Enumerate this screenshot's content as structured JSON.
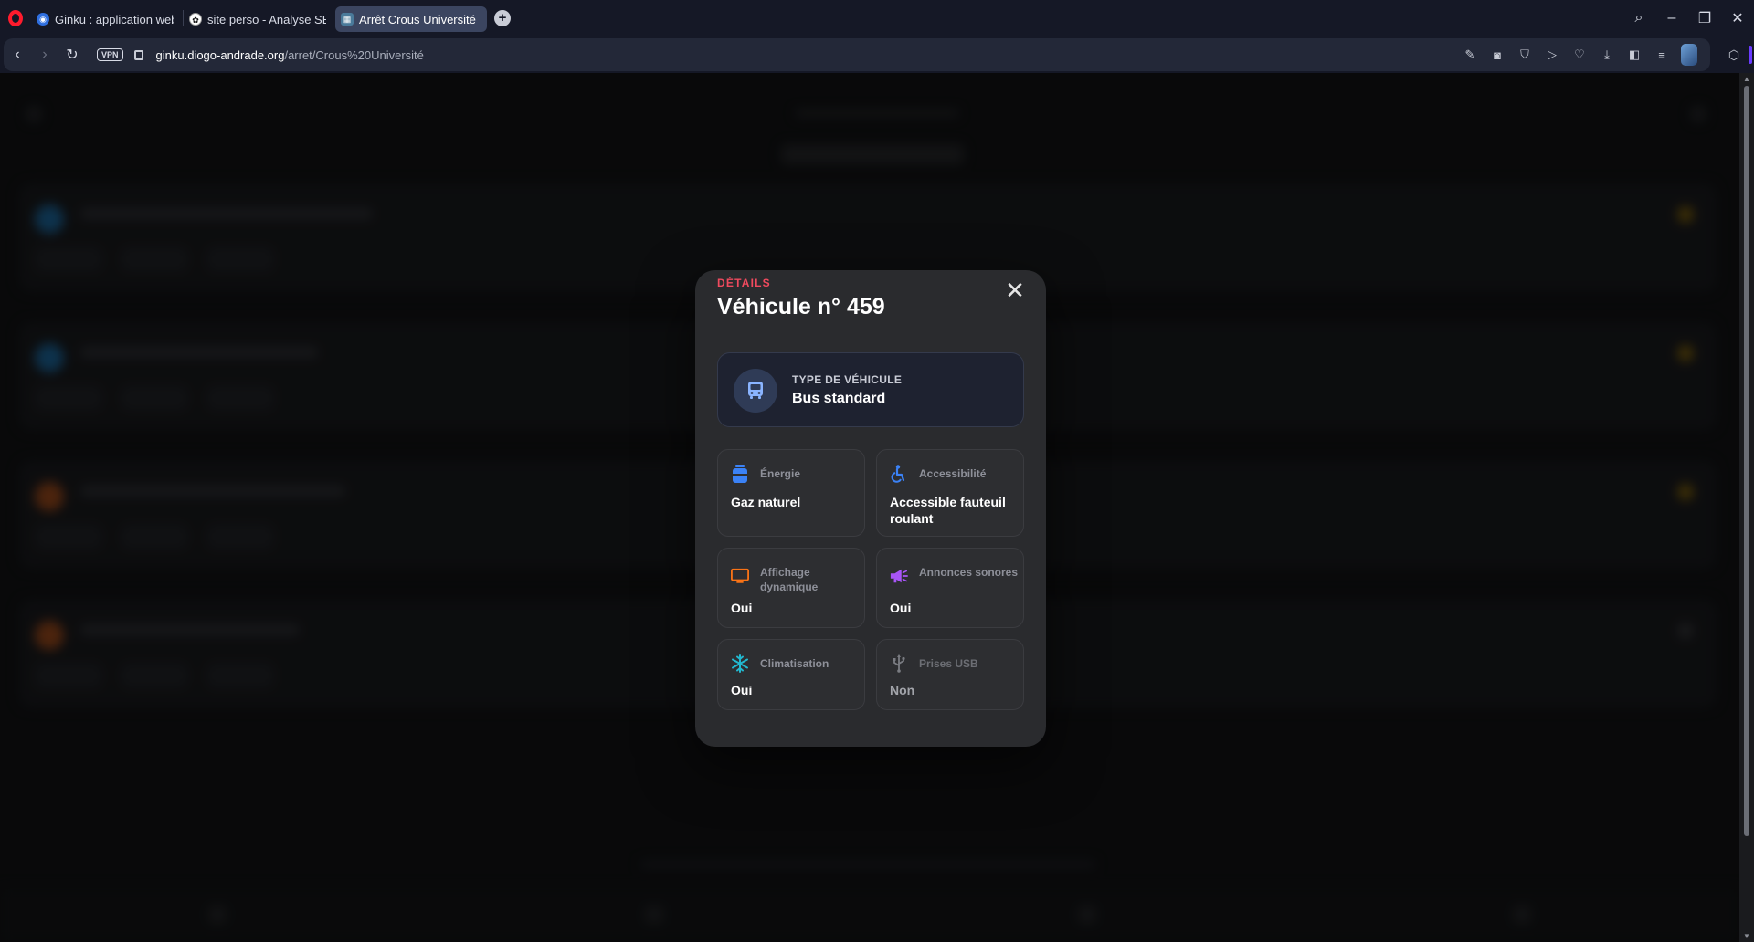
{
  "browser": {
    "tabs": [
      {
        "label": "Ginku : application web et",
        "active": false,
        "favicon": "ginku-favicon"
      },
      {
        "label": "site perso - Analyse SEO d",
        "active": false,
        "favicon": "openai-favicon"
      },
      {
        "label": "Arrêt Crous Université — (",
        "active": true,
        "favicon": "ginku-tab-favicon"
      }
    ],
    "new_tab_label": "+",
    "vpn_label": "VPN",
    "url_domain": "ginku.diogo-andrade.org",
    "url_path": "/arret/Crous%20Université"
  },
  "modal": {
    "kicker": "DÉTAILS",
    "title": "Véhicule n° 459",
    "close_label": "✕",
    "vehicle_type": {
      "label": "TYPE DE VÉHICULE",
      "value": "Bus standard",
      "icon": "bus-icon"
    },
    "features": [
      {
        "label": "Énergie",
        "value": "Gaz naturel",
        "icon": "gas-tank-icon",
        "color": "#3b82f6",
        "enabled": true
      },
      {
        "label": "Accessibilité",
        "value": "Accessible fauteuil roulant",
        "icon": "wheelchair-icon",
        "color": "#3b82f6",
        "enabled": true
      },
      {
        "label": "Affichage dynamique",
        "value": "Oui",
        "icon": "screen-icon",
        "color": "#f97316",
        "enabled": true
      },
      {
        "label": "Annonces sonores",
        "value": "Oui",
        "icon": "megaphone-icon",
        "color": "#a855f7",
        "enabled": true
      },
      {
        "label": "Climatisation",
        "value": "Oui",
        "icon": "snowflake-icon",
        "color": "#22b8cf",
        "enabled": true
      },
      {
        "label": "Prises USB",
        "value": "Non",
        "icon": "usb-icon",
        "color": "#7a7c82",
        "enabled": false
      }
    ]
  },
  "colors": {
    "accent_red": "#ef4a5e",
    "modal_bg": "#2a2b2e",
    "type_card_bg": "#1e2230"
  }
}
